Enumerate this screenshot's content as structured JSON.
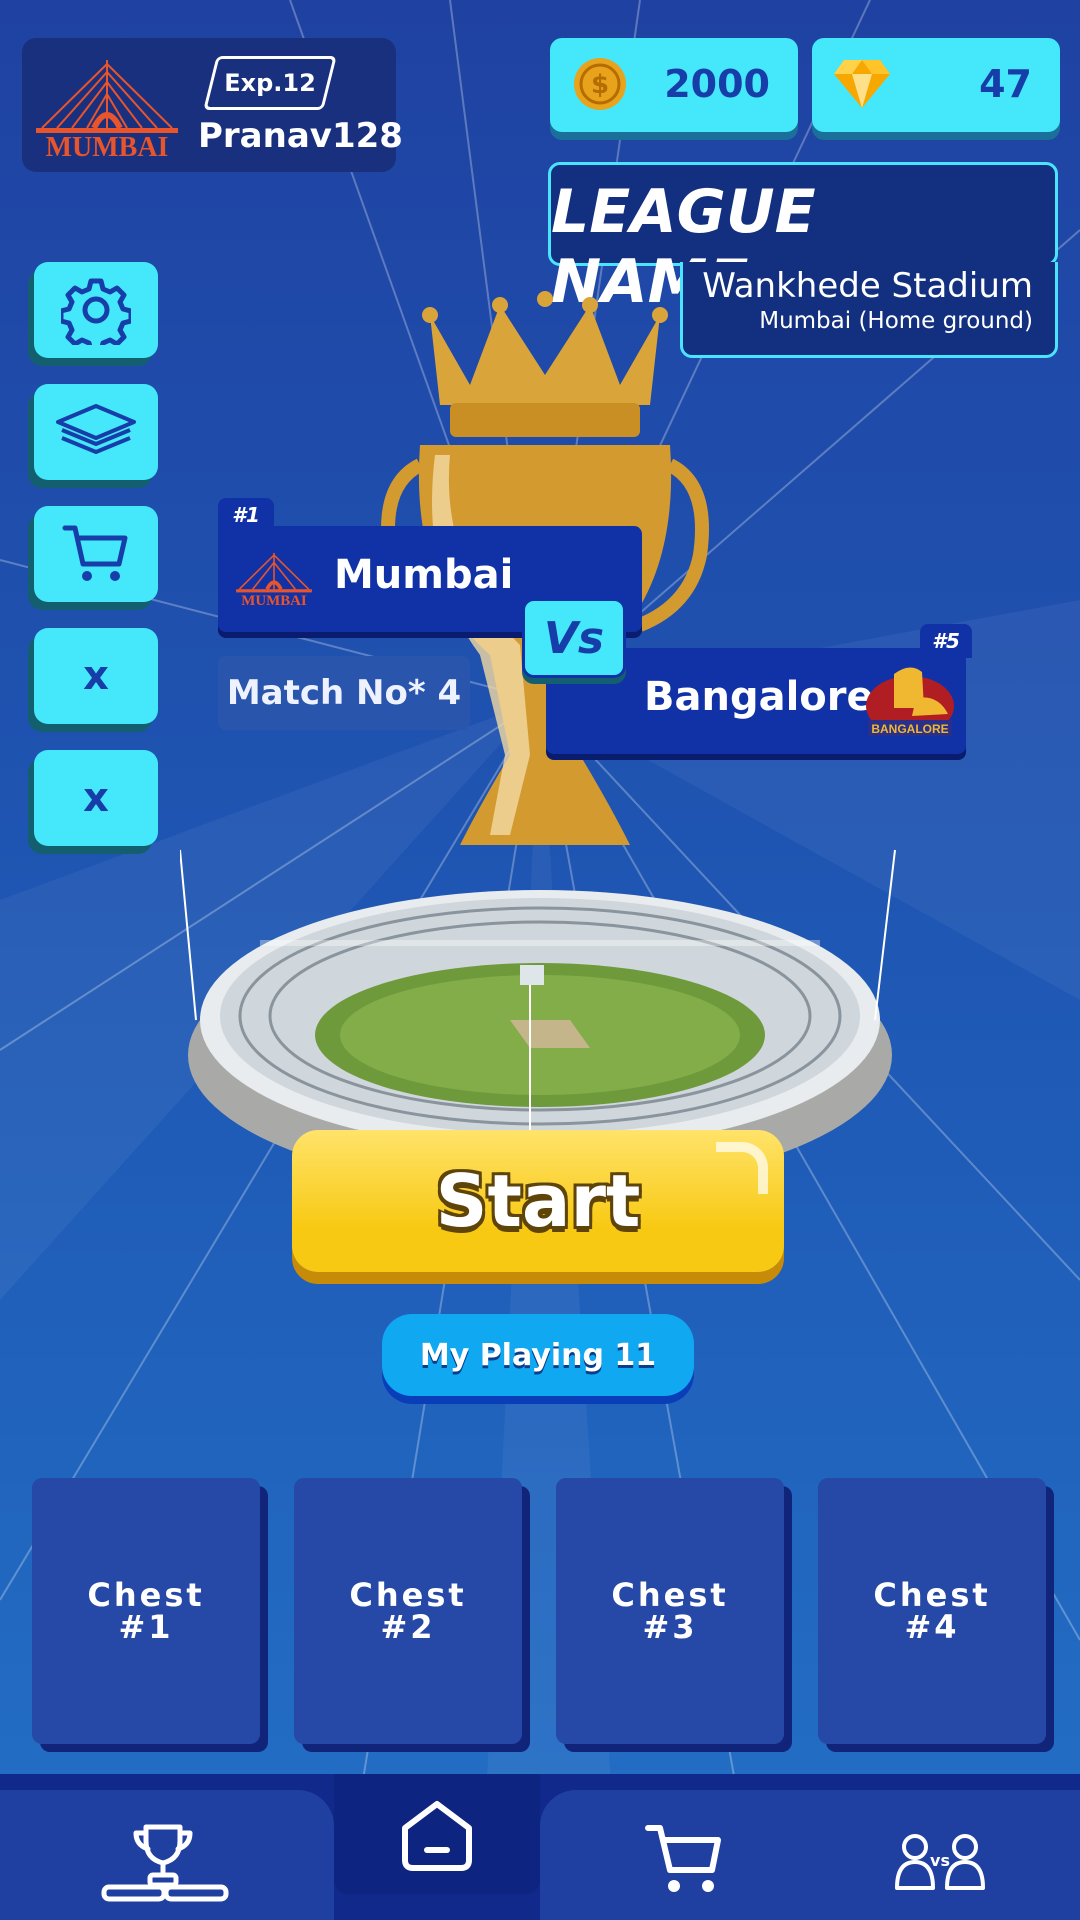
{
  "colors": {
    "background": "#1d47a3",
    "accent_cyan": "#45e8fb",
    "panel_dark": "#12307f",
    "start_yellow": "#f8c912",
    "team_blue": "#1132a6"
  },
  "profile": {
    "team_logo": "mumbai-bridge-logo",
    "team_logo_text": "MUMBAI",
    "exp_label": "Exp.12",
    "player_name": "Pranav128"
  },
  "currency": {
    "coins": "2000",
    "coin_icon": "coin-icon",
    "gems": "47",
    "gem_icon": "diamond-icon"
  },
  "league": {
    "title": "LEAGUE NAME",
    "stadium": "Wankhede Stadium",
    "location": "Mumbai (Home ground)"
  },
  "side_menu": [
    {
      "icon": "gear-icon"
    },
    {
      "icon": "layers-icon"
    },
    {
      "icon": "cart-icon"
    },
    {
      "label": "x"
    },
    {
      "label": "x"
    }
  ],
  "match": {
    "home": {
      "rank": "#1",
      "name": "Mumbai",
      "logo": "mumbai-bridge-logo",
      "logo_text": "MUMBAI"
    },
    "away": {
      "rank": "#5",
      "name": "Bangalore",
      "logo": "bangalore-lion-logo",
      "logo_text": "BANGALORE"
    },
    "vs_label": "Vs",
    "match_no": "Match No* 4"
  },
  "actions": {
    "start_label": "Start",
    "playing11_label": "My Playing 11"
  },
  "chests": [
    {
      "label": "Chest\n#1"
    },
    {
      "label": "Chest\n#2"
    },
    {
      "label": "Chest\n#3"
    },
    {
      "label": "Chest\n#4"
    }
  ],
  "bottom_nav": [
    {
      "icon": "trophy-podium-icon",
      "active": false
    },
    {
      "icon": "home-icon",
      "active": true
    },
    {
      "icon": "cart-icon",
      "active": false
    },
    {
      "icon": "versus-players-icon",
      "active": false
    }
  ]
}
